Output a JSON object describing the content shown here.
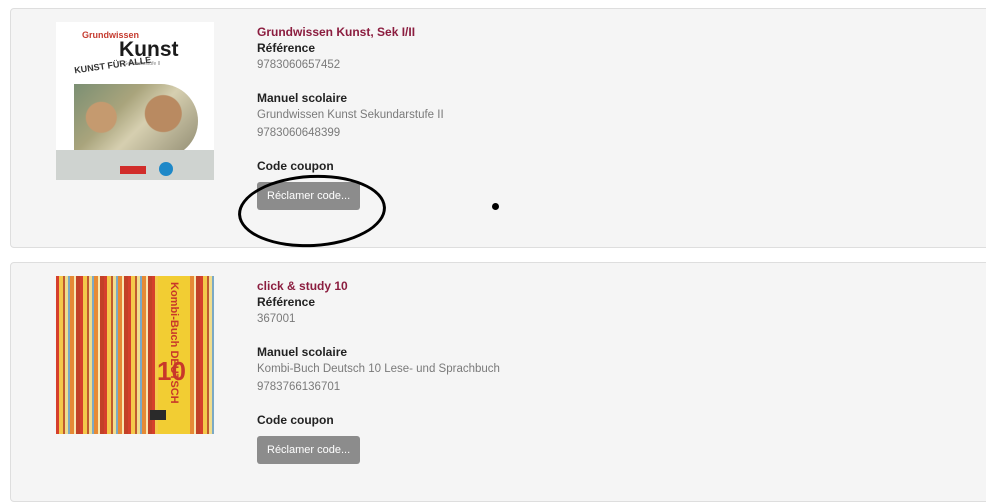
{
  "products": [
    {
      "title": "Grundwissen Kunst, Sek I/II",
      "reference_label": "Référence",
      "reference": "9783060657452",
      "manual_label": "Manuel scolaire",
      "manual_name": "Grundwissen Kunst Sekundarstufe II",
      "manual_isbn": "9783060648399",
      "coupon_label": "Code coupon",
      "button_label": "Réclamer code...",
      "cover": {
        "header_small": "Grundwissen",
        "header_big": "Kunst",
        "subtitle": "Sekundarstufe II",
        "scribble": "KUNST FÜR ALLE"
      }
    },
    {
      "title": "click & study 10",
      "reference_label": "Référence",
      "reference": "367001",
      "manual_label": "Manuel scolaire",
      "manual_name": "Kombi-Buch Deutsch 10 Lese- und Sprachbuch",
      "manual_isbn": "9783766136701",
      "coupon_label": "Code coupon",
      "button_label": "Réclamer code...",
      "cover": {
        "vertical_title": "Kombi-Buch DEUTSCH",
        "number": "10"
      }
    }
  ]
}
